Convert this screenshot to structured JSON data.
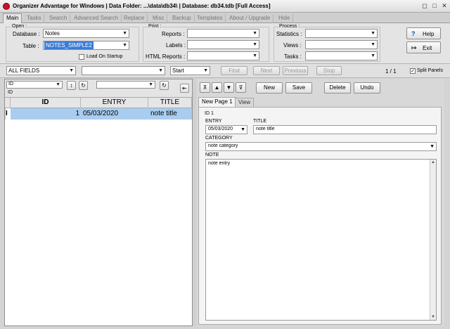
{
  "window": {
    "title": "Organizer Advantage for Windows | Data Folder: ...\\data\\db34\\ | Database: db34.tdb [Full Access]"
  },
  "tabs": [
    {
      "label": "Main",
      "active": true
    },
    {
      "label": "Tasks"
    },
    {
      "label": "Search"
    },
    {
      "label": "Advanced Search"
    },
    {
      "label": "Replace"
    },
    {
      "label": "Misc"
    },
    {
      "label": "Backup"
    },
    {
      "label": "Templates"
    },
    {
      "label": "About / Upgrade"
    },
    {
      "label": "Hide"
    }
  ],
  "ribbon": {
    "open": {
      "title": "Open :",
      "database_label": "Database :",
      "database_value": "Notes",
      "table_label": "Table :",
      "table_value": "NOTES_SIMPLE2",
      "load_on_startup": "Load On Startup"
    },
    "print": {
      "title": "Print :",
      "reports_label": "Reports :",
      "labels_label": "Labels :",
      "html_reports_label": "HTML Reports :"
    },
    "process": {
      "title": "Process :",
      "statistics_label": "Statistics :",
      "views_label": "Views :",
      "tasks_label": "Tasks :"
    },
    "help_label": "Help",
    "exit_label": "Exit"
  },
  "filterbar": {
    "field_value": "ALL FIELDS",
    "mode_value": "Start",
    "find": "Find",
    "next": "Next",
    "previous": "Previous",
    "stop": "Stop",
    "record_count": "1 / 1",
    "split_panels": "Split Panels"
  },
  "left": {
    "sort_field": "ID",
    "sort_field_sub": "ID",
    "grid": {
      "columns": [
        "ID",
        "ENTRY",
        "TITLE"
      ],
      "rows": [
        {
          "marker": "I",
          "id": "1",
          "entry": "05/03/2020",
          "title": "note title"
        }
      ]
    }
  },
  "right": {
    "buttons": {
      "new": "New",
      "save": "Save",
      "delete": "Delete",
      "undo": "Undo"
    },
    "page_tabs": [
      {
        "label": "New Page 1",
        "active": true
      },
      {
        "label": "View"
      }
    ],
    "form": {
      "id_label": "ID 1",
      "entry_label": "ENTRY",
      "entry_value": "05/03/2020",
      "title_label": "TITLE",
      "title_value": "note title",
      "category_label": "CATEGORY",
      "category_value": "note category",
      "note_label": "NOTE",
      "note_value": "note entry"
    }
  }
}
